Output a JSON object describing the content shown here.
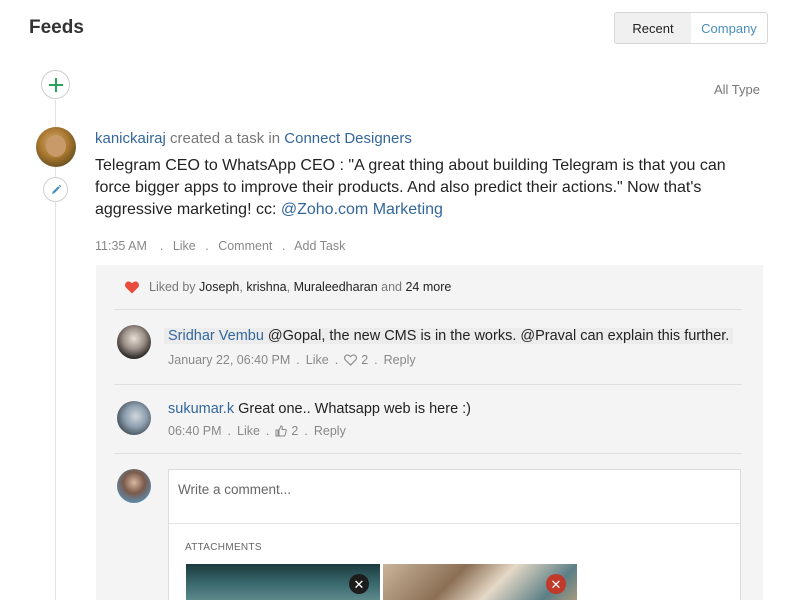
{
  "header": {
    "title": "Feeds"
  },
  "filter_tabs": {
    "recent": "Recent",
    "company": "Company"
  },
  "all_type": "All Type",
  "post": {
    "author": "kanickairaj",
    "action": "created a task in",
    "group": "Connect Designers",
    "body_text": "Telegram CEO to WhatsApp CEO : \"A great thing about building Telegram is that you can force bigger apps to improve their products. And also predict their actions.\" Now that's aggressive marketing! cc: ",
    "mention": "@Zoho.com Marketing",
    "time": "11:35 AM",
    "like": "Like",
    "comment": "Comment",
    "add_task": "Add Task"
  },
  "likes": {
    "prefix": "Liked by",
    "name1": "Joseph",
    "name2": "krishna",
    "name3": "Muraleedharan",
    "and": "and",
    "more": "24 more"
  },
  "comments": [
    {
      "author": "Sridhar Vembu",
      "text": "@Gopal, the new CMS is in the works. @Praval can explain this further.",
      "time": "January 22, 06:40 PM",
      "like": "Like",
      "count": "2",
      "reply": "Reply"
    },
    {
      "author": "sukumar.k",
      "text": "Great one.. Whatsapp web is here :)",
      "time": "06:40 PM",
      "like": "Like",
      "count": "2",
      "reply": "Reply"
    }
  ],
  "compose": {
    "placeholder": "Write a comment...",
    "attachments_label": "ATTACHMENTS"
  },
  "colors": {
    "link": "#33679c",
    "accent_green": "#2aa35a",
    "heart": "#e74c3c"
  },
  "icons": [
    "plus-icon",
    "pencil-icon",
    "heart-icon",
    "heart-outline-icon",
    "thumbs-up-icon",
    "close-icon"
  ]
}
